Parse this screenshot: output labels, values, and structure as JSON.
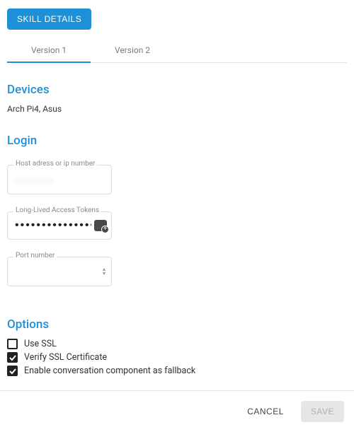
{
  "header": {
    "skill_details_label": "SKILL DETAILS",
    "tabs": [
      "Version 1",
      "Version 2"
    ],
    "active_tab": 0
  },
  "sections": {
    "devices_title": "Devices",
    "devices_value": "Arch Pi4, Asus",
    "login_title": "Login",
    "options_title": "Options"
  },
  "fields": {
    "host": {
      "label": "Host adress or ip number",
      "value": "xxxxxxxx"
    },
    "token": {
      "label": "Long-Lived Access Tokens",
      "value": "•••••••••••••••••"
    },
    "port": {
      "label": "Port number",
      "value": ""
    }
  },
  "options": {
    "use_ssl": {
      "label": "Use SSL",
      "checked": false
    },
    "verify": {
      "label": "Verify SSL Certificate",
      "checked": true
    },
    "fallback": {
      "label": "Enable conversation component as fallback",
      "checked": true
    }
  },
  "footer": {
    "cancel_label": "CANCEL",
    "save_label": "SAVE"
  }
}
